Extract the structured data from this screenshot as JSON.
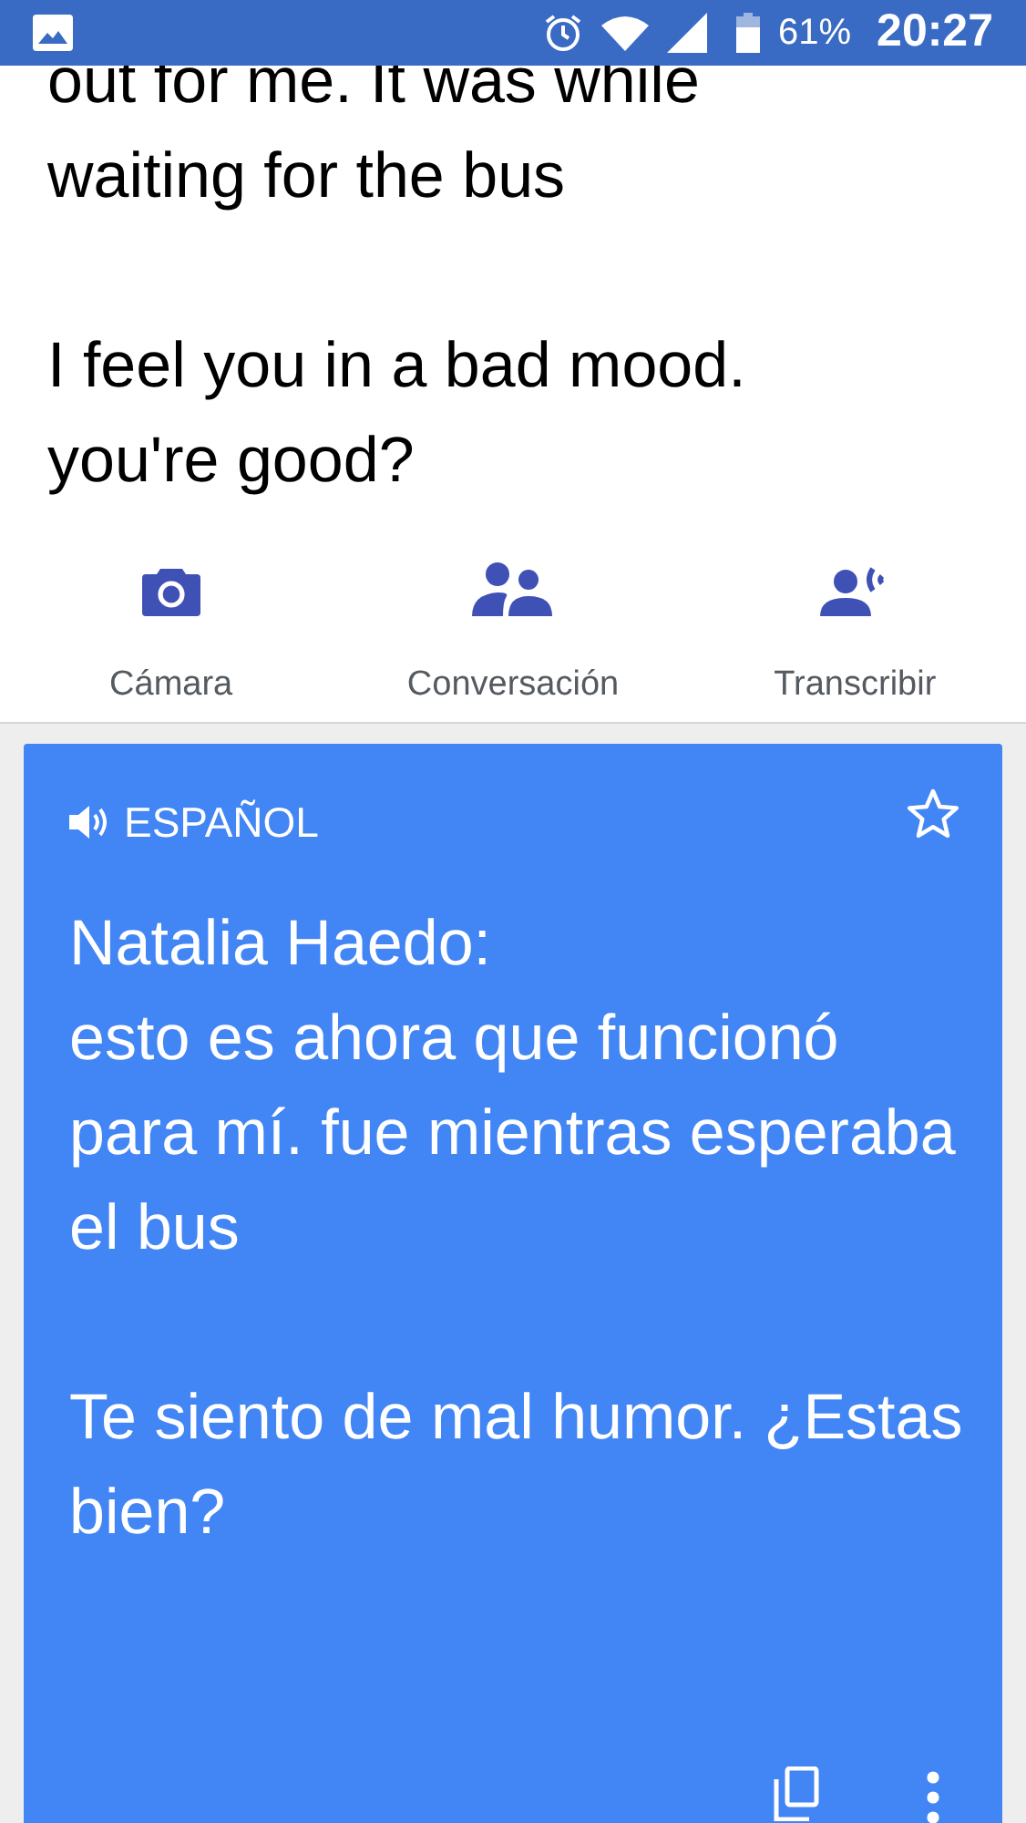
{
  "status_bar": {
    "battery": "61%",
    "time": "20:27"
  },
  "source_text": "out for me. It was while\nwaiting for the bus\n\n I feel you in a bad mood.\nyou're good?",
  "modes": [
    {
      "kind": "camera",
      "label": "Cámara"
    },
    {
      "kind": "conversation",
      "label": "Conversación"
    },
    {
      "kind": "transcribe",
      "label": "Transcribir"
    }
  ],
  "translation": {
    "language": "ESPAÑOL",
    "starred": false,
    "text": "Natalia Haedo:\n esto es ahora que funcionó para mí.  fue mientras esperaba el bus\n\n Te siento de mal humor. ¿Estas bien?"
  }
}
